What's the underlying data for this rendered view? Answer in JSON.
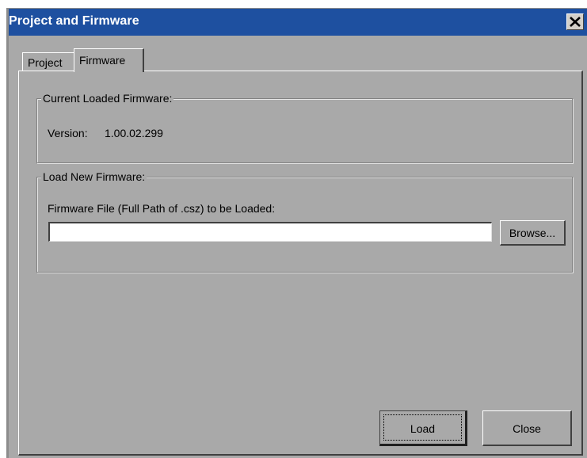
{
  "window": {
    "title": "Project and Firmware"
  },
  "tabs": [
    {
      "label": "Project",
      "selected": false
    },
    {
      "label": "Firmware",
      "selected": true
    }
  ],
  "current_firmware": {
    "legend": "Current Loaded Firmware:",
    "version_label": "Version:",
    "version_value": "1.00.02.299"
  },
  "load_firmware": {
    "legend": "Load New Firmware:",
    "file_label": "Firmware File (Full Path of .csz) to be Loaded:",
    "file_value": "",
    "browse_label": "Browse..."
  },
  "buttons": {
    "load_label": "Load",
    "close_label": "Close"
  },
  "icons": {
    "close": "close-icon"
  },
  "colors": {
    "titlebar": "#1e50a0",
    "dialog_bg": "#a9a9a9"
  }
}
